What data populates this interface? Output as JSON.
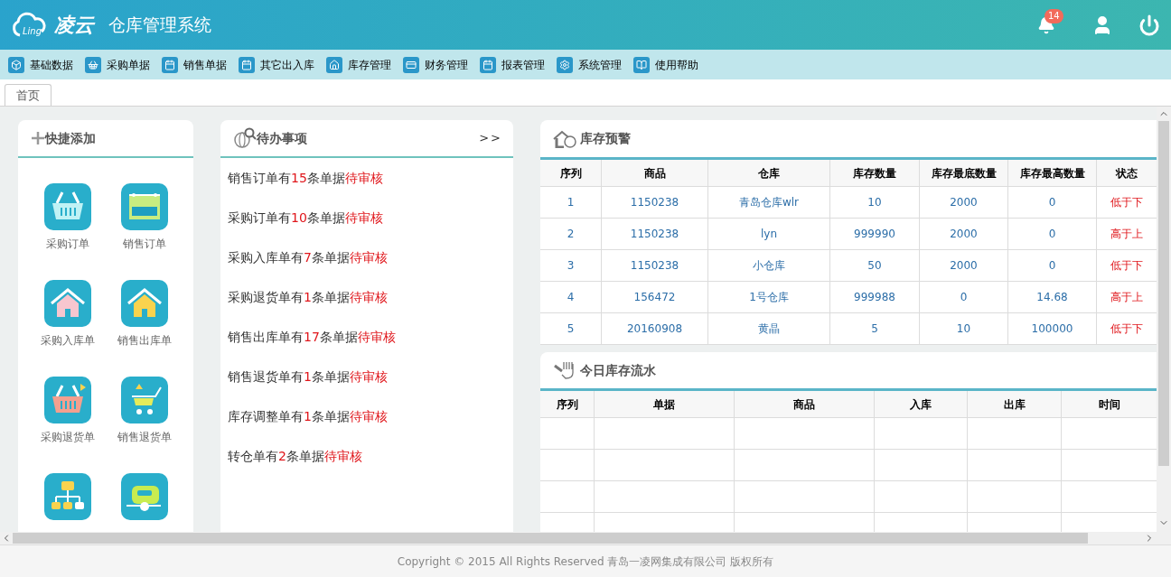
{
  "header": {
    "logo_text": "Ling",
    "brand": "凌云",
    "title": "仓库管理系统",
    "notification_count": "14"
  },
  "menu": [
    {
      "label": "基础数据"
    },
    {
      "label": "采购单据"
    },
    {
      "label": "销售单据"
    },
    {
      "label": "其它出入库"
    },
    {
      "label": "库存管理"
    },
    {
      "label": "财务管理"
    },
    {
      "label": "报表管理"
    },
    {
      "label": "系统管理"
    },
    {
      "label": "使用帮助"
    }
  ],
  "tabs": [
    {
      "label": "首页",
      "selected": true
    }
  ],
  "quick_add": {
    "title": "快捷添加",
    "items": [
      {
        "label": "采购订单"
      },
      {
        "label": "销售订单"
      },
      {
        "label": "采购入库单"
      },
      {
        "label": "销售出库单"
      },
      {
        "label": "采购退货单"
      },
      {
        "label": "销售退货单"
      }
    ]
  },
  "todo": {
    "title": "待办事项",
    "more": ">>",
    "items": [
      {
        "prefix": "销售订单有",
        "count": "15",
        "middle": "条单据",
        "status": "待审核"
      },
      {
        "prefix": "采购订单有",
        "count": "10",
        "middle": "条单据",
        "status": "待审核"
      },
      {
        "prefix": "采购入库单有",
        "count": "7",
        "middle": "条单据",
        "status": "待审核"
      },
      {
        "prefix": "采购退货单有",
        "count": "1",
        "middle": "条单据",
        "status": "待审核"
      },
      {
        "prefix": "销售出库单有",
        "count": "17",
        "middle": "条单据",
        "status": "待审核"
      },
      {
        "prefix": "销售退货单有",
        "count": "1",
        "middle": "条单据",
        "status": "待审核"
      },
      {
        "prefix": "库存调整单有",
        "count": "1",
        "middle": "条单据",
        "status": "待审核"
      },
      {
        "prefix": "转仓单有",
        "count": "2",
        "middle": "条单据",
        "status": "待审核"
      }
    ]
  },
  "stock_warning": {
    "title": "库存预警",
    "columns": [
      "序列",
      "商品",
      "仓库",
      "库存数量",
      "库存最底数量",
      "库存最高数量",
      "状态"
    ],
    "rows": [
      [
        "1",
        "1150238",
        "青岛仓库wlr",
        "10",
        "2000",
        "0",
        "低于下"
      ],
      [
        "2",
        "1150238",
        "lyn",
        "999990",
        "2000",
        "0",
        "高于上"
      ],
      [
        "3",
        "1150238",
        "小仓库",
        "50",
        "2000",
        "0",
        "低于下"
      ],
      [
        "4",
        "156472",
        "1号仓库",
        "999988",
        "0",
        "14.68",
        "高于上"
      ],
      [
        "5",
        "20160908",
        "黄晶",
        "5",
        "10",
        "100000",
        "低于下"
      ]
    ]
  },
  "stock_flow": {
    "title": "今日库存流水",
    "columns": [
      "序列",
      "单据",
      "商品",
      "入库",
      "出库",
      "时间"
    ]
  },
  "footer": "Copyright © 2015 All Rights Reserved 青岛一凌网集成有限公司 版权所有"
}
